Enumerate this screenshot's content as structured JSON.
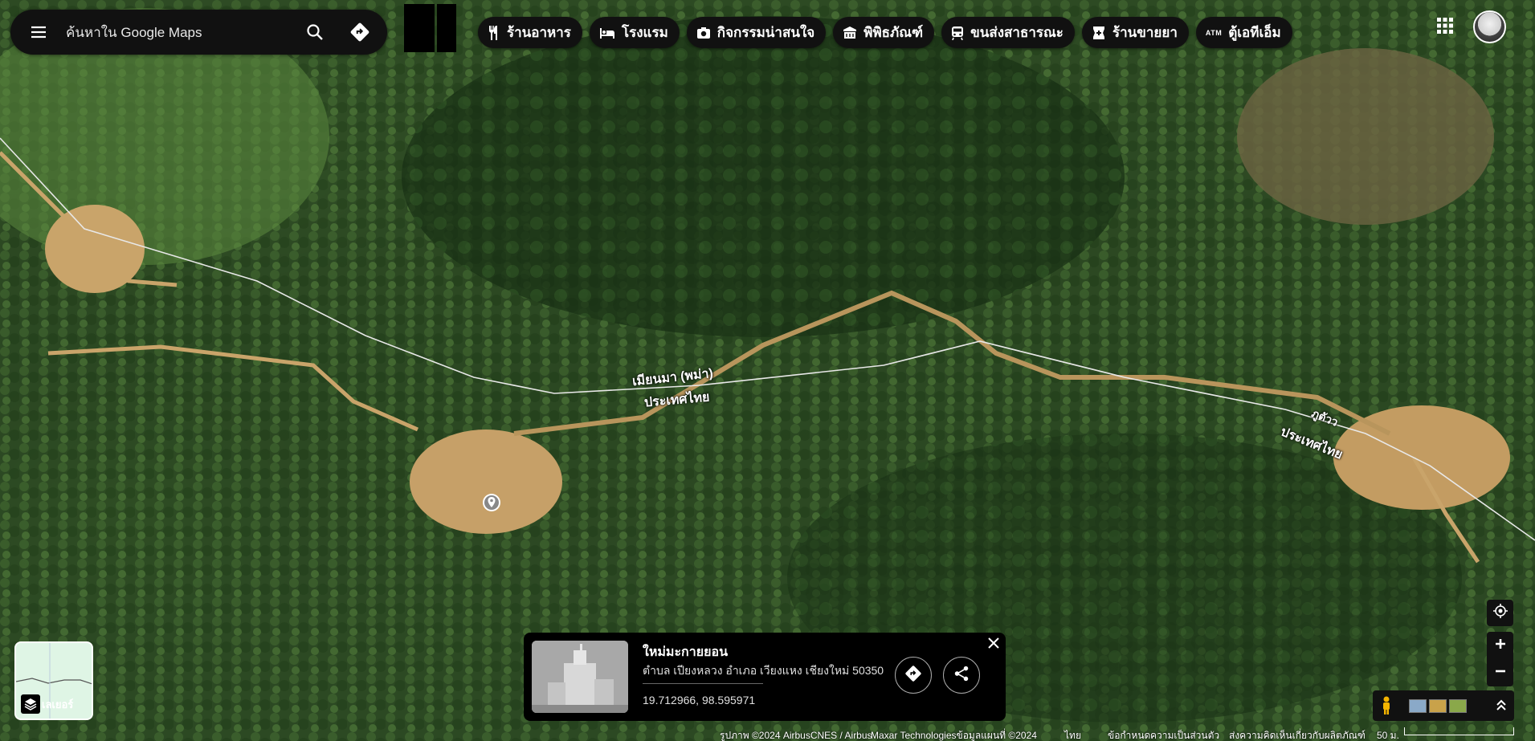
{
  "search": {
    "placeholder": "ค้นหาใน Google Maps"
  },
  "chips": [
    {
      "label": "ร้านอาหาร",
      "icon": "restaurant-icon"
    },
    {
      "label": "โรงแรม",
      "icon": "hotel-icon"
    },
    {
      "label": "กิจกรรมน่าสนใจ",
      "icon": "camera-icon"
    },
    {
      "label": "พิพิธภัณฑ์",
      "icon": "museum-icon"
    },
    {
      "label": "ขนส่งสาธารณะ",
      "icon": "transit-icon"
    },
    {
      "label": "ร้านขายยา",
      "icon": "pharmacy-icon"
    },
    {
      "label": "ตู้เอทีเอ็ม",
      "icon": "atm-icon",
      "icon_text": "ATM"
    }
  ],
  "map_labels": {
    "border_myanmar": "เมียนมา (พม่า)",
    "border_thailand": "ประเทศไทย",
    "border_myanmar_short": "ภูตัวว",
    "border_thailand_right": "ประเทศไทย"
  },
  "place": {
    "title": "ใหม่มะกายยอน",
    "address": "ตำบล เปียงหลวง อำเภอ เวียงแหง เชียงใหม่ 50350",
    "coords": "19.712966, 98.595971"
  },
  "layers": {
    "label": "เลเยอร์"
  },
  "footer": {
    "imagery": "รูปภาพ ©2024 AirbusCNES / Airbus",
    "map_data": "Maxar Technologiesข้อมูลแผนที่ ©2024",
    "language": "ไทย",
    "terms": "ข้อกำหนด",
    "privacy": "ความเป็นส่วนตัว",
    "feedback": "ส่งความคิดเห็นเกี่ยวกับผลิตภัณฑ์",
    "scale": "50 ม."
  },
  "colors": {
    "control_bg": "#111111",
    "border_line": "#e8e8e8",
    "dirt": "#c9a46a"
  }
}
